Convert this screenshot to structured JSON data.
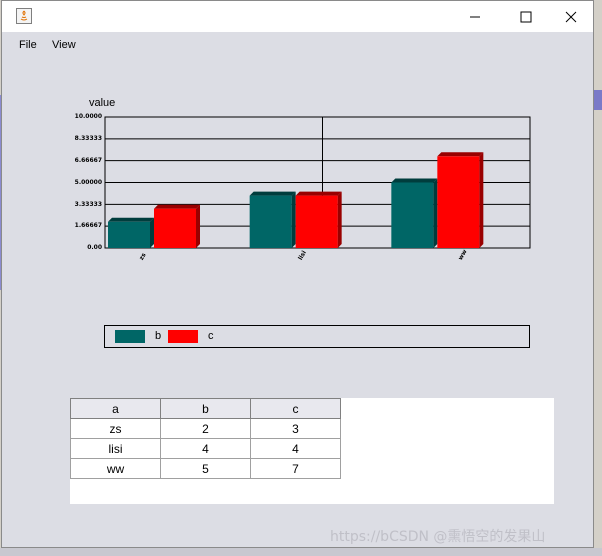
{
  "window": {
    "menu": [
      {
        "label": "File"
      },
      {
        "label": "View"
      }
    ]
  },
  "chart_data": {
    "type": "bar",
    "ylabel": "value",
    "categories": [
      "zs",
      "lisi",
      "ww"
    ],
    "series": [
      {
        "name": "b",
        "values": [
          2,
          4,
          5
        ],
        "color": "#006666"
      },
      {
        "name": "c",
        "values": [
          3,
          4,
          7
        ],
        "color": "#ff0000"
      }
    ],
    "ylim": [
      0,
      10
    ],
    "yticks": [
      "10.0000",
      "8.33333",
      "6.66667",
      "5.00000",
      "3.33333",
      "1.66667",
      "0.00"
    ],
    "grid": true,
    "legend_position": "bottom"
  },
  "table": {
    "headers": [
      "a",
      "b",
      "c"
    ],
    "rows": [
      [
        "zs",
        "2",
        "3"
      ],
      [
        "lisi",
        "4",
        "4"
      ],
      [
        "ww",
        "5",
        "7"
      ]
    ]
  },
  "watermark": "https://bCSDN @熏悟空的发果山"
}
